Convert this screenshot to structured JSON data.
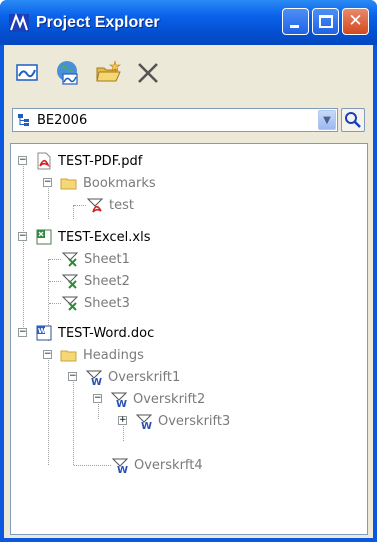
{
  "window": {
    "title": "Project Explorer"
  },
  "toolbar": {
    "buttons": [
      "link-icon",
      "globe-link-icon",
      "open-folder-icon",
      "delete-icon"
    ]
  },
  "selector": {
    "value": "BE2006"
  },
  "tree": {
    "nodes": [
      {
        "label": "TEST-PDF.pdf"
      },
      {
        "label": "Bookmarks"
      },
      {
        "label": "test"
      },
      {
        "label": "TEST-Excel.xls"
      },
      {
        "label": "Sheet1"
      },
      {
        "label": "Sheet2"
      },
      {
        "label": "Sheet3"
      },
      {
        "label": "TEST-Word.doc"
      },
      {
        "label": "Headings"
      },
      {
        "label": "Overskrift1"
      },
      {
        "label": "Overskrift2"
      },
      {
        "label": "Overskrift3"
      },
      {
        "label": "Overskrft4"
      }
    ]
  },
  "colors": {
    "titlebar": "#0a58e0",
    "client": "#ece9d8",
    "tree_text_gray": "#7a7a7a"
  }
}
